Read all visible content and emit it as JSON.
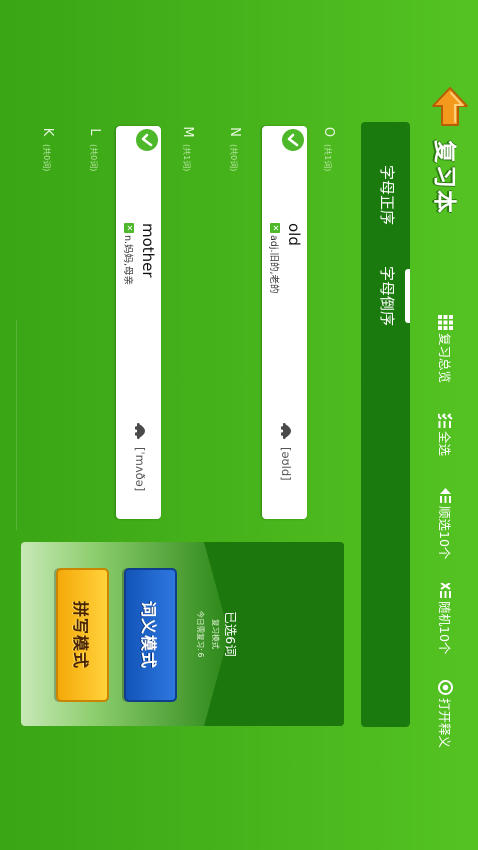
{
  "header": {
    "title": "复习本",
    "toolbar": [
      {
        "label": "复习总览",
        "icon": "grid-icon"
      },
      {
        "label": "全选",
        "icon": "select-all-icon"
      },
      {
        "label": "顺选10个",
        "icon": "sequence-select-icon"
      },
      {
        "label": "随机10个",
        "icon": "random-select-icon"
      },
      {
        "label": "打开释义",
        "icon": "eye-icon"
      }
    ]
  },
  "tabs": {
    "forward": "字母正序",
    "reverse": "字母倒序",
    "active": "reverse"
  },
  "letters": [
    {
      "letter": "O",
      "count": "(共1词)"
    },
    {
      "letter": "N",
      "count": "(共0词)"
    },
    {
      "letter": "M",
      "count": "(共1词)"
    },
    {
      "letter": "L",
      "count": "(共0词)"
    },
    {
      "letter": "K",
      "count": "(共0词)"
    }
  ],
  "words": [
    {
      "word": "old",
      "meaning": "adj.旧的,老的",
      "phonetic": "[əʊld]",
      "checked": true
    },
    {
      "word": "mother",
      "meaning": "n.妈妈,母亲",
      "phonetic": "[ˈmʌðə]",
      "checked": true
    }
  ],
  "mode_panel": {
    "selected": "已选6词",
    "subtitle": "复习模式",
    "today_label": "今日需复习:",
    "today_count": "6",
    "meaning_mode": "词义模式",
    "spelling_mode": "拼写模式"
  },
  "colors": {
    "background": "#46b41e",
    "panel_dark": "#1b7a0e",
    "accent_orange": "#f39a1c",
    "blue_button": "#1a5fc7",
    "yellow_button": "#f8be1c"
  }
}
